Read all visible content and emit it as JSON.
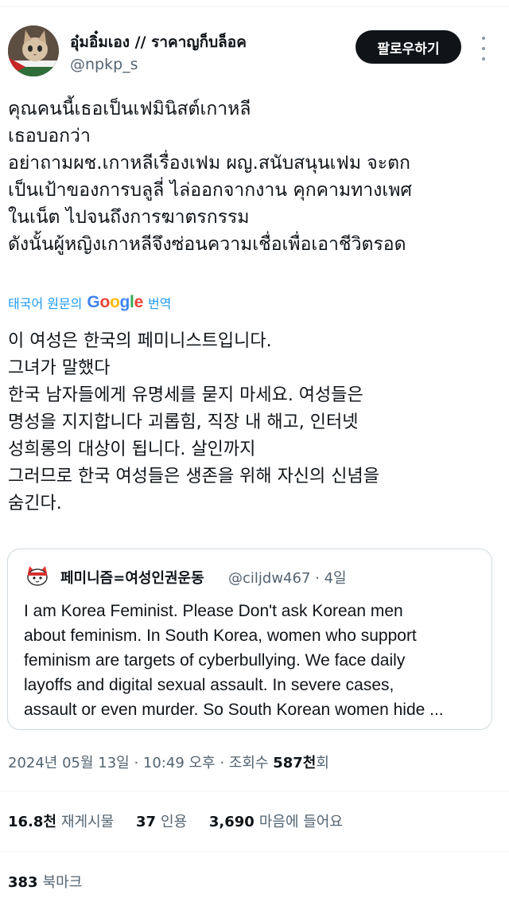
{
  "author": {
    "display_name": "อุ๋มอิ๋มเอง // ราคาญก็บล็อค",
    "handle": "@npkp_s",
    "avatar": "avatar-cat-icon"
  },
  "follow_button": {
    "label": "팔로우하기"
  },
  "more_menu": {
    "icon": "more-vertical-icon"
  },
  "tweet_text_lines": [
    "คุณคนนี้เธอเป็นเฟมินิสต์เกาหลี",
    "เธอบอกว่า",
    "อย่าถามผช.เกาหลีเรื่องเฟม ผญ.สนับสนุนเฟม จะตก",
    "เป็นเป้าของการบลูลี่ ไล่ออกจากงาน คุกคามทางเพศ",
    "ในเน็ต ไปจนถึงการฆาตรกรรม",
    "ดังนั้นผู้หญิงเกาหลีจึงซ่อนความเชื่อเพื่อเอาชีวิตรอด"
  ],
  "translate_link": {
    "prefix": "태국어 원문의",
    "google": "Google",
    "suffix": "번역"
  },
  "translation_lines": [
    "이 여성은 한국의 페미니스트입니다.",
    "그녀가 말했다",
    "한국 남자들에게 유명세를 묻지 마세요. 여성들은",
    "명성을 지지합니다 괴롭힘, 직장 내 해고, 인터넷",
    "성희롱의 대상이 됩니다. 살인까지",
    "그러므로 한국 여성들은 생존을 위해 자신의 신념을",
    "숨긴다."
  ],
  "quote_tweet": {
    "avatar": "avatar-cat-icon",
    "display_name": "페미니즘=여성인권운동",
    "handle": "@ciljdw467",
    "separator": "·",
    "age": "4일",
    "text_lines": [
      "I am Korea Feminist. Please Don't ask Korean men",
      "about feminism. In South Korea, women who support",
      "feminism are targets of cyberbullying. We face daily",
      "layoffs and digital sexual assault. In severe cases,",
      "assault or even murder. So South Korean women hide ..."
    ]
  },
  "timestamp": {
    "date_time": "2024년 05월 13일 · 10:49 오후 · 조회수",
    "views": "587천",
    "views_suffix": "회"
  },
  "stats": {
    "reposts_count": "16.8천",
    "reposts_label": "재게시물",
    "quotes_count": "37",
    "quotes_label": "인용",
    "likes_count": "3,690",
    "likes_label": "마음에 들어요"
  },
  "bookmarks": {
    "count": "383",
    "label": "북마크"
  },
  "colors": {
    "text": "#0f1419",
    "secondary": "#536471",
    "link": "#1d9bf0",
    "button_bg": "#0f1419",
    "border": "#cfd9de"
  }
}
